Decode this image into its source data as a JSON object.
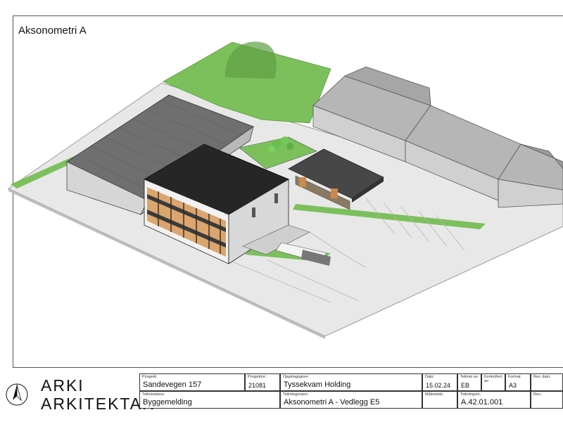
{
  "sheet": {
    "view_title": "Aksonometri A"
  },
  "logo": {
    "line1": "ARKI",
    "line2": "ARKITEKTAR",
    "north_arrow": "north-arrow-icon"
  },
  "title_block": {
    "prosjekt": {
      "label": "Prosjekt:",
      "value": "Sandevegen 157"
    },
    "prosjektnr": {
      "label": "Prosjektnr.:",
      "value": "21081"
    },
    "oppdragsgiver": {
      "label": "Oppdragsgiver:",
      "value": "Tyssekvam Holding"
    },
    "dato": {
      "label": "Dato:",
      "value": "15.02.24"
    },
    "teiknet_av": {
      "label": "Teiknet av:",
      "value": "EB"
    },
    "kontrollert_av": {
      "label": "Kontrollert av:",
      "value": ""
    },
    "format": {
      "label": "Format:",
      "value": "A3"
    },
    "rev_dato": {
      "label": "Rev. dato:",
      "value": ""
    },
    "teiknestatus": {
      "label": "Teiknestatus:",
      "value": "Byggemelding"
    },
    "teikningsnavn": {
      "label": "Teikningsnavn:",
      "value": "Aksonometri A - Vedlegg E5"
    },
    "malestokk": {
      "label": "Målestokk:",
      "value": ""
    },
    "teikningsnr": {
      "label": "Teikningsnr.:",
      "value": "A.42.01.001"
    },
    "rev": {
      "label": "Rev.:",
      "value": ""
    }
  },
  "colors": {
    "grass": "#7cc05b",
    "roof_dark": "#2b2b2b",
    "roof_grey": "#8c8c8c",
    "wall_grey": "#cfcfcf",
    "timber": "#d9a56c",
    "ground": "#e6e6e6"
  }
}
